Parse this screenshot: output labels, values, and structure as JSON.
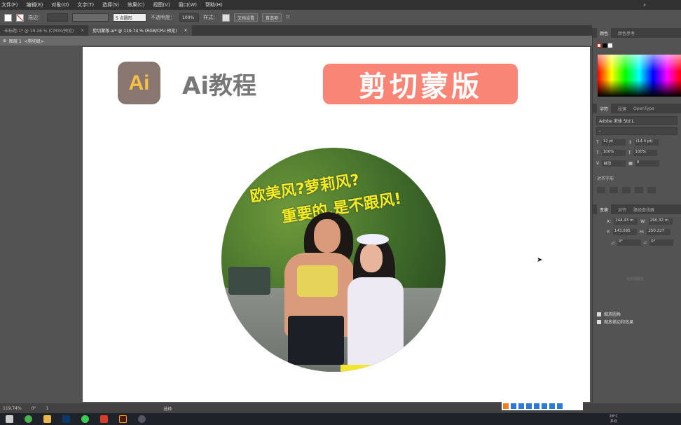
{
  "menu": [
    "文件(F)",
    "编辑(E)",
    "对象(O)",
    "文字(T)",
    "选择(S)",
    "效果(C)",
    "视图(V)",
    "窗口(W)",
    "帮助(H)"
  ],
  "control": {
    "stroke_label": "描边：",
    "brush": "5 点圆形",
    "opacity_label": "不透明度：",
    "opacity": "100%",
    "style_label": "样式：",
    "doc_setup": "文档设置",
    "prefs": "首选项"
  },
  "tabs": [
    {
      "label": "未标题-1* @ 19.26 % (CMYK/预览)",
      "active": false
    },
    {
      "label": "剪切蒙版.ai* @ 119.74 % (RGB/CPU 预览)",
      "active": true
    }
  ],
  "breadcrumb": {
    "layer": "图层 1",
    "group": "<剪切组>"
  },
  "artboard": {
    "logo": "Ai",
    "tutorial": "Ai教程",
    "badge": "剪切蒙版",
    "photo_line1": "欧美风?萝莉风?",
    "photo_line2": "重要的,是不跟风!"
  },
  "panel": {
    "color_tabs": [
      "颜色",
      "颜色参考"
    ],
    "char_tabs": [
      "字符",
      "段落",
      "OpenType"
    ],
    "font": "Adobe 宋体 Std L",
    "font_style": "-",
    "size": "12 pt",
    "leading": "(14.4 pt)",
    "scale_v": "100%",
    "scale_h": "100%",
    "kerning": "自动",
    "tracking": "0",
    "snap_label": "对齐字形",
    "transform_tabs": [
      "变换",
      "对齐",
      "路径查找器"
    ],
    "x": "144.43 m",
    "w": "260.32 m",
    "y": "143.095",
    "h": "250.227",
    "angle": "0°",
    "shear": "0°",
    "no_props": "无外观属性",
    "check1": "缩放圆角",
    "check2": "缩放描边和效果"
  },
  "status": {
    "zoom": "119.74%",
    "angle": "0°",
    "page": "1",
    "tool": "选择"
  },
  "taskbar": {
    "weather": "28°C",
    "weather_desc": "多云"
  },
  "colors": {
    "badge": "#f88575",
    "logo_bg": "#8a7670",
    "logo_fg": "#f7c148",
    "photo_text": "#f3ee1e"
  }
}
